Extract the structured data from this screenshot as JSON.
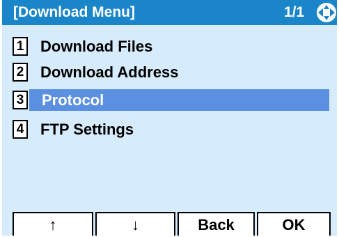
{
  "header": {
    "title": "[Download Menu]",
    "page_indicator": "1/1",
    "nav_icon": "four-way-navigation-icon"
  },
  "menu": {
    "selected_index": 2,
    "items": [
      {
        "number": "1",
        "label": "Download Files"
      },
      {
        "number": "2",
        "label": "Download Address"
      },
      {
        "number": "3",
        "label": "Protocol"
      },
      {
        "number": "4",
        "label": "FTP Settings"
      }
    ]
  },
  "softkeys": {
    "up": "↑",
    "down": "↓",
    "back": "Back",
    "ok": "OK"
  },
  "colors": {
    "title_bar": "#1a86c9",
    "screen_background": "#d6ebfb",
    "selection": "#5b8fe0"
  }
}
